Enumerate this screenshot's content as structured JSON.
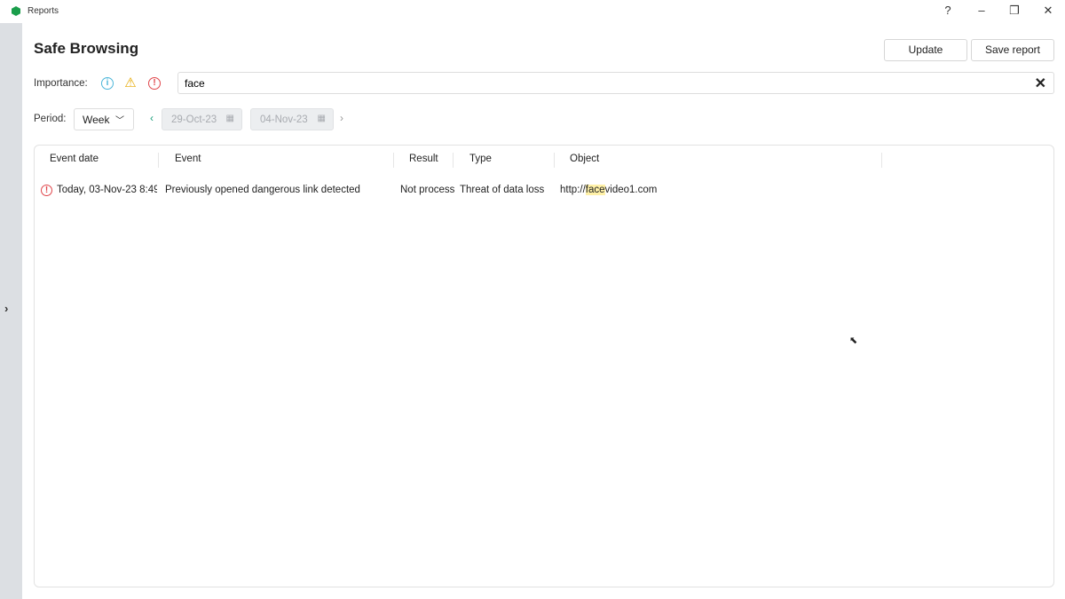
{
  "window": {
    "title": "Reports",
    "help": "?",
    "minimize": "–",
    "restore": "❐",
    "close": "✕"
  },
  "sidebar": {
    "expand": "›"
  },
  "page": {
    "title": "Safe Browsing",
    "update": "Update",
    "save_report": "Save report"
  },
  "filters": {
    "importance_label": "Importance:",
    "search_value": "face",
    "search_clear": "✕",
    "period_label": "Period:",
    "period_value": "Week",
    "date_from": "29-Oct-23",
    "date_to": "04-Nov-23"
  },
  "table": {
    "headers": [
      "Event date",
      "Event",
      "Result",
      "Type",
      "Object"
    ],
    "rows": [
      {
        "date": "Today, 03-Nov-23 8:49:…",
        "event": "Previously opened dangerous link detected",
        "result": "Not process",
        "type": "Threat of data loss",
        "object_prefix": "http://",
        "object_match": "face",
        "object_suffix": "video1.com"
      }
    ]
  },
  "colors": {
    "info": "#4bb5d9",
    "warning": "#e6a800",
    "error": "#e0464b",
    "highlight": "#fff1a8"
  }
}
